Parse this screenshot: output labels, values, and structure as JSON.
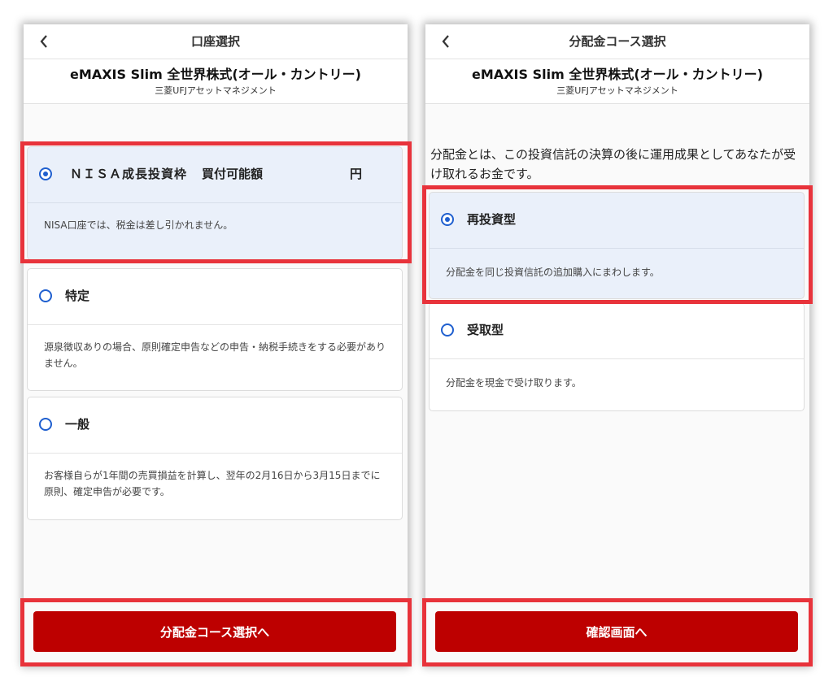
{
  "fund": {
    "name": "eMAXIS Slim 全世界株式(オール・カントリー)",
    "company": "三菱UFJアセットマネジメント"
  },
  "left_screen": {
    "title": "口座選択",
    "options": [
      {
        "label": "ＮＩＳＡ成長投資枠",
        "available_label": "買付可能額",
        "currency": "円",
        "description": "NISA口座では、税金は差し引かれません。",
        "selected": true
      },
      {
        "label": "特定",
        "description": "源泉徴収ありの場合、原則確定申告などの申告・納税手続きをする必要がありません。",
        "selected": false
      },
      {
        "label": "一般",
        "description": "お客様自らが1年間の売買損益を計算し、翌年の2月16日から3月15日までに原則、確定申告が必要です。",
        "selected": false
      }
    ],
    "button_label": "分配金コース選択へ"
  },
  "right_screen": {
    "title": "分配金コース選択",
    "intro": "分配金とは、この投資信託の決算の後に運用成果としてあなたが受け取れるお金です。",
    "options": [
      {
        "label": "再投資型",
        "description": "分配金を同じ投資信託の追加購入にまわします。",
        "selected": true
      },
      {
        "label": "受取型",
        "description": "分配金を現金で受け取ります。",
        "selected": false
      }
    ],
    "button_label": "確認画面へ"
  },
  "icons": {
    "back": "chevron-left-icon",
    "radio_selected": "radio-selected-icon",
    "radio_unselected": "radio-unselected-icon"
  },
  "colors": {
    "accent_blue": "#1f5fcf",
    "selected_bg": "#eaf0fa",
    "button_red": "#bd0000",
    "highlight_red": "#e8333b"
  }
}
